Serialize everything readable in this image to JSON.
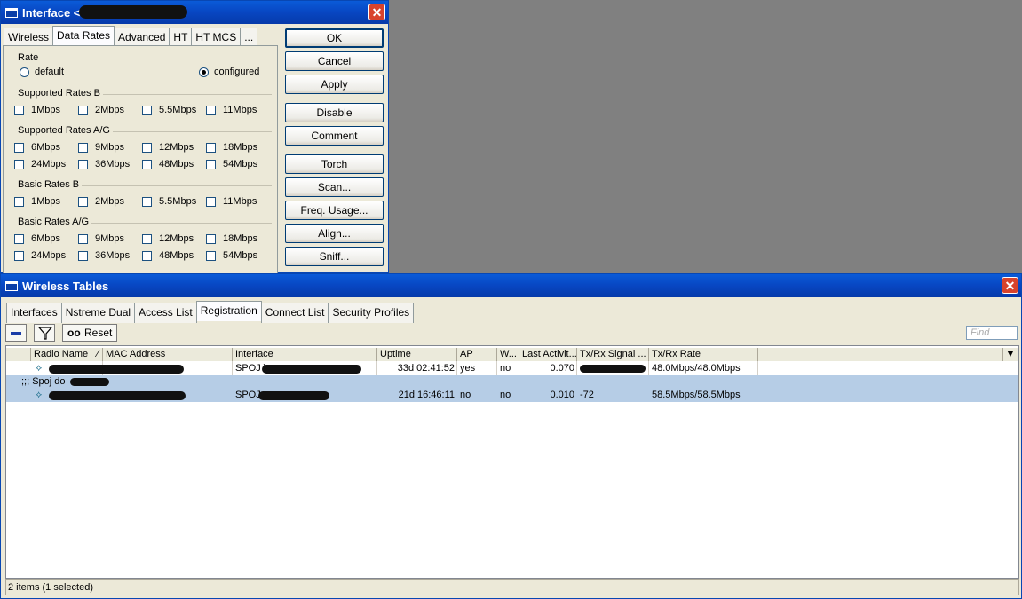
{
  "interface_window": {
    "title": "Interface <",
    "tabs": [
      "Wireless",
      "Data Rates",
      "Advanced",
      "HT",
      "HT MCS",
      "..."
    ],
    "active_tab": "Data Rates",
    "rate_group": "Rate",
    "rate_options": [
      "default",
      "configured"
    ],
    "rate_selected": "configured",
    "groups": [
      {
        "label": "Supported Rates B",
        "rows": [
          [
            "1Mbps",
            "2Mbps",
            "5.5Mbps",
            "11Mbps"
          ]
        ]
      },
      {
        "label": "Supported Rates A/G",
        "rows": [
          [
            "6Mbps",
            "9Mbps",
            "12Mbps",
            "18Mbps"
          ],
          [
            "24Mbps",
            "36Mbps",
            "48Mbps",
            "54Mbps"
          ]
        ]
      },
      {
        "label": "Basic Rates B",
        "rows": [
          [
            "1Mbps",
            "2Mbps",
            "5.5Mbps",
            "11Mbps"
          ]
        ]
      },
      {
        "label": "Basic Rates A/G",
        "rows": [
          [
            "6Mbps",
            "9Mbps",
            "12Mbps",
            "18Mbps"
          ],
          [
            "24Mbps",
            "36Mbps",
            "48Mbps",
            "54Mbps"
          ]
        ]
      }
    ],
    "buttons": [
      "OK",
      "Cancel",
      "Apply",
      "Disable",
      "Comment",
      "Torch",
      "Scan...",
      "Freq. Usage...",
      "Align...",
      "Sniff..."
    ]
  },
  "wireless_tables": {
    "title": "Wireless Tables",
    "tabs": [
      "Interfaces",
      "Nstreme Dual",
      "Access List",
      "Registration",
      "Connect List",
      "Security Profiles"
    ],
    "active_tab": "Registration",
    "reset_label": "Reset",
    "reset_glyph": "oo",
    "find_placeholder": "Find",
    "columns": [
      "Radio Name",
      "MAC Address",
      "Interface",
      "Uptime",
      "AP",
      "W...",
      "Last Activit...",
      "Tx/Rx Signal ...",
      "Tx/Rx Rate"
    ],
    "rows": [
      {
        "interface": "SPOJ \\",
        "uptime": "33d 02:41:52",
        "ap": "yes",
        "w": "no",
        "last_activity": "0.070",
        "signal": "",
        "rate": "48.0Mbps/48.0Mbps",
        "selected": false
      },
      {
        "interface": "SPOJ",
        "uptime": "21d 16:46:11",
        "ap": "no",
        "w": "no",
        "last_activity": "0.010",
        "signal": "-72",
        "rate": "58.5Mbps/58.5Mbps",
        "selected": true
      }
    ],
    "comment": ";;; Spoj do",
    "status": "2 items (1 selected)"
  },
  "colors": {
    "titlebar": "#0846c2",
    "window_bg": "#ece9d8",
    "selection": "#b6cde6",
    "close": "#d9432c",
    "desktop": "#808080"
  }
}
